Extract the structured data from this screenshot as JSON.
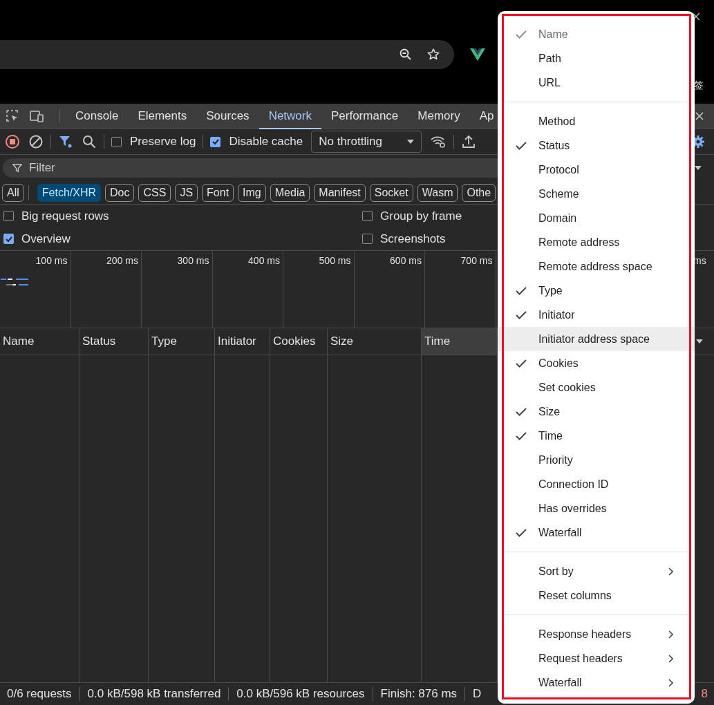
{
  "browser": {
    "edge_text": "签"
  },
  "devtools": {
    "tabs": [
      {
        "label": "Console",
        "selected": false
      },
      {
        "label": "Elements",
        "selected": false
      },
      {
        "label": "Sources",
        "selected": false
      },
      {
        "label": "Network",
        "selected": true
      },
      {
        "label": "Performance",
        "selected": false
      },
      {
        "label": "Memory",
        "selected": false
      },
      {
        "label": "Ap",
        "selected": false
      }
    ],
    "toolbar": {
      "preserve_log": {
        "label": "Preserve log",
        "checked": false
      },
      "disable_cache": {
        "label": "Disable cache",
        "checked": true
      },
      "throttling": "No throttling"
    },
    "filter": {
      "placeholder": "Filter"
    },
    "type_filters": [
      {
        "label": "All",
        "selected": false
      },
      {
        "label": "Fetch/XHR",
        "selected": true
      },
      {
        "label": "Doc",
        "selected": false
      },
      {
        "label": "CSS",
        "selected": false
      },
      {
        "label": "JS",
        "selected": false
      },
      {
        "label": "Font",
        "selected": false
      },
      {
        "label": "Img",
        "selected": false
      },
      {
        "label": "Media",
        "selected": false
      },
      {
        "label": "Manifest",
        "selected": false
      },
      {
        "label": "Socket",
        "selected": false
      },
      {
        "label": "Wasm",
        "selected": false
      },
      {
        "label": "Othe",
        "selected": false
      }
    ],
    "options_left": [
      {
        "label": "Big request rows",
        "checked": false
      },
      {
        "label": "Overview",
        "checked": true
      }
    ],
    "options_right": [
      {
        "label": "Group by frame",
        "checked": false
      },
      {
        "label": "Screenshots",
        "checked": false
      }
    ],
    "overview_ticks": [
      "100 ms",
      "200 ms",
      "300 ms",
      "400 ms",
      "500 ms",
      "600 ms",
      "700 ms"
    ],
    "overview_edge_tick": "ms",
    "table": {
      "columns": [
        {
          "label": "Name",
          "sorted": false
        },
        {
          "label": "Status",
          "sorted": false
        },
        {
          "label": "Type",
          "sorted": false
        },
        {
          "label": "Initiator",
          "sorted": false
        },
        {
          "label": "Cookies",
          "sorted": false
        },
        {
          "label": "Size",
          "sorted": false
        },
        {
          "label": "Time",
          "sorted": true
        }
      ]
    },
    "status_bar": [
      "0/6 requests",
      "0.0 kB/598 kB transferred",
      "0.0 kB/596 kB resources",
      "Finish: 876 ms",
      "D"
    ],
    "status_edge": "8"
  },
  "context_menu": {
    "sections": [
      [
        {
          "label": "Name",
          "checked": true,
          "disabled": true,
          "highlighted": false,
          "submenu": false
        },
        {
          "label": "Path",
          "checked": false,
          "disabled": false,
          "highlighted": false,
          "submenu": false
        },
        {
          "label": "URL",
          "checked": false,
          "disabled": false,
          "highlighted": false,
          "submenu": false
        }
      ],
      [
        {
          "label": "Method",
          "checked": false,
          "disabled": false,
          "highlighted": false,
          "submenu": false
        },
        {
          "label": "Status",
          "checked": true,
          "disabled": false,
          "highlighted": false,
          "submenu": false
        },
        {
          "label": "Protocol",
          "checked": false,
          "disabled": false,
          "highlighted": false,
          "submenu": false
        },
        {
          "label": "Scheme",
          "checked": false,
          "disabled": false,
          "highlighted": false,
          "submenu": false
        },
        {
          "label": "Domain",
          "checked": false,
          "disabled": false,
          "highlighted": false,
          "submenu": false
        },
        {
          "label": "Remote address",
          "checked": false,
          "disabled": false,
          "highlighted": false,
          "submenu": false
        },
        {
          "label": "Remote address space",
          "checked": false,
          "disabled": false,
          "highlighted": false,
          "submenu": false
        },
        {
          "label": "Type",
          "checked": true,
          "disabled": false,
          "highlighted": false,
          "submenu": false
        },
        {
          "label": "Initiator",
          "checked": true,
          "disabled": false,
          "highlighted": false,
          "submenu": false
        },
        {
          "label": "Initiator address space",
          "checked": false,
          "disabled": false,
          "highlighted": true,
          "submenu": false
        },
        {
          "label": "Cookies",
          "checked": true,
          "disabled": false,
          "highlighted": false,
          "submenu": false
        },
        {
          "label": "Set cookies",
          "checked": false,
          "disabled": false,
          "highlighted": false,
          "submenu": false
        },
        {
          "label": "Size",
          "checked": true,
          "disabled": false,
          "highlighted": false,
          "submenu": false
        },
        {
          "label": "Time",
          "checked": true,
          "disabled": false,
          "highlighted": false,
          "submenu": false
        },
        {
          "label": "Priority",
          "checked": false,
          "disabled": false,
          "highlighted": false,
          "submenu": false
        },
        {
          "label": "Connection ID",
          "checked": false,
          "disabled": false,
          "highlighted": false,
          "submenu": false
        },
        {
          "label": "Has overrides",
          "checked": false,
          "disabled": false,
          "highlighted": false,
          "submenu": false
        },
        {
          "label": "Waterfall",
          "checked": true,
          "disabled": false,
          "highlighted": false,
          "submenu": false
        }
      ],
      [
        {
          "label": "Sort by",
          "checked": false,
          "disabled": false,
          "highlighted": false,
          "submenu": true
        },
        {
          "label": "Reset columns",
          "checked": false,
          "disabled": false,
          "highlighted": false,
          "submenu": false
        }
      ],
      [
        {
          "label": "Response headers",
          "checked": false,
          "disabled": false,
          "highlighted": false,
          "submenu": true
        },
        {
          "label": "Request headers",
          "checked": false,
          "disabled": false,
          "highlighted": false,
          "submenu": true
        },
        {
          "label": "Waterfall",
          "checked": false,
          "disabled": false,
          "highlighted": false,
          "submenu": true
        }
      ]
    ]
  }
}
